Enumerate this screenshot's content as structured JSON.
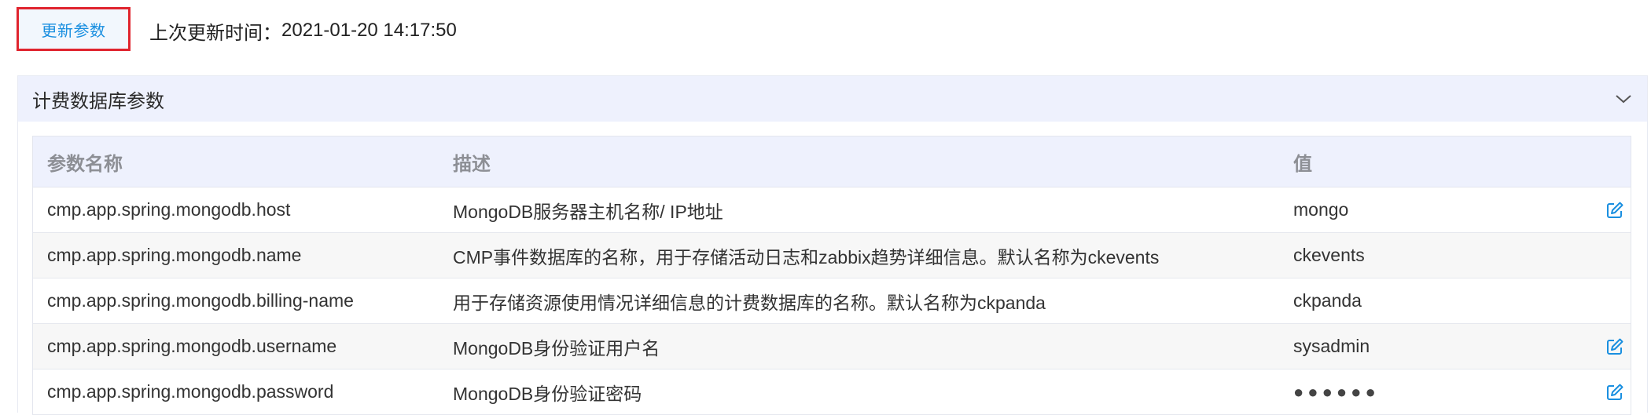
{
  "toolbar": {
    "update_button_label": "更新参数",
    "last_update_label": "上次更新时间：",
    "last_update_value": "2021-01-20 14:17:50"
  },
  "panel": {
    "title": "计费数据库参数",
    "collapse_icon": "chevron-down-icon"
  },
  "table": {
    "columns": [
      "参数名称",
      "描述",
      "值"
    ],
    "rows": [
      {
        "name": "cmp.app.spring.mongodb.host",
        "description": "MongoDB服务器主机名称/ IP地址",
        "value": "mongo",
        "editable": true
      },
      {
        "name": "cmp.app.spring.mongodb.name",
        "description": "CMP事件数据库的名称，用于存储活动日志和zabbix趋势详细信息。默认名称为ckevents",
        "value": "ckevents",
        "editable": false
      },
      {
        "name": "cmp.app.spring.mongodb.billing-name",
        "description": "用于存储资源使用情况详细信息的计费数据库的名称。默认名称为ckpanda",
        "value": "ckpanda",
        "editable": false
      },
      {
        "name": "cmp.app.spring.mongodb.username",
        "description": "MongoDB身份验证用户名",
        "value": "sysadmin",
        "editable": true
      },
      {
        "name": "cmp.app.spring.mongodb.password",
        "description": "MongoDB身份验证密码",
        "value": "●●●●●●",
        "editable": true
      }
    ],
    "edit_icon": "edit-icon"
  },
  "colors": {
    "accent": "#1a8fe0",
    "highlight_border": "#e0242e",
    "header_bg": "#eef1fd",
    "alt_row_bg": "#f7f7f7"
  }
}
